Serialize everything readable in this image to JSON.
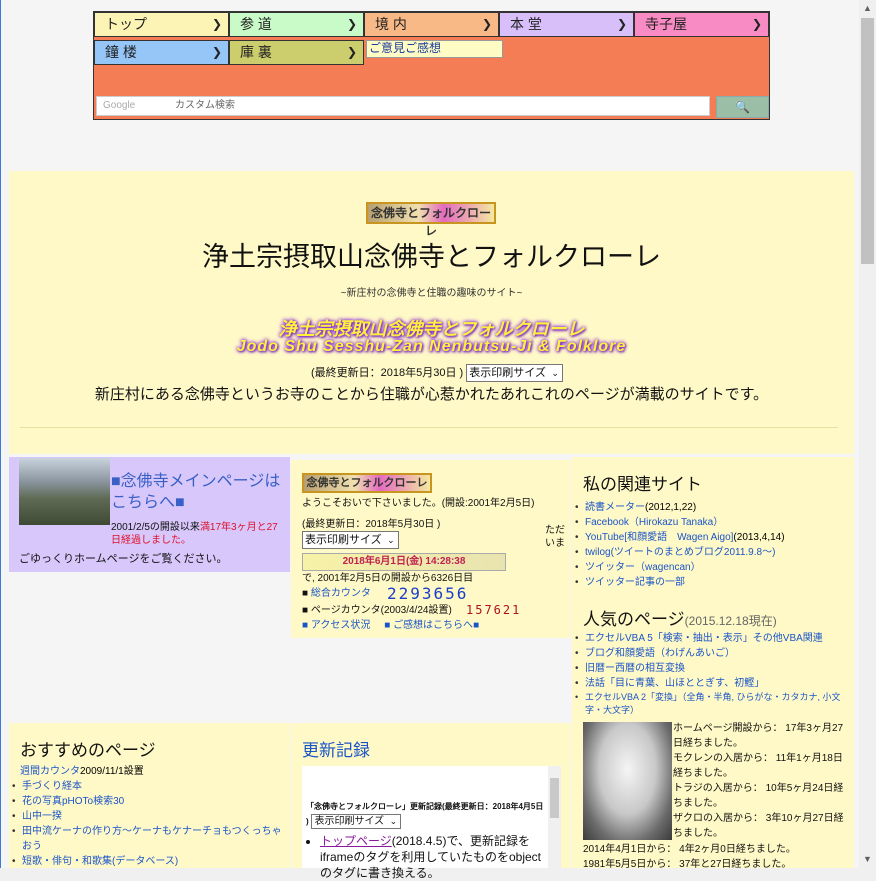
{
  "nav": {
    "items": [
      {
        "label": "トップ",
        "color": "#fcf4b5"
      },
      {
        "label": "参 道",
        "color": "#c9fbc9"
      },
      {
        "label": "境 内",
        "color": "#f9b987"
      },
      {
        "label": "本 堂",
        "color": "#d8bffa"
      },
      {
        "label": "寺子屋",
        "color": "#f98bc4"
      },
      {
        "label": "鐘 楼",
        "color": "#96c5f8"
      },
      {
        "label": "庫 裏",
        "color": "#cccd6c"
      }
    ],
    "dropdown_item": "ご意見ご感想",
    "search_logo": "Google",
    "search_placeholder": "カスタム検索"
  },
  "banner": {
    "logo_text": "念佛寺とフォルクローレ",
    "title": "浄土宗摂取山念佛寺とフォルクローレ",
    "subtitle": "~新庄村の念佛寺と住職の趣味のサイト~",
    "fancy_title_jp": "浄土宗摂取山念佛寺とフォルクローレ",
    "fancy_title_en": "Jodo Shu Sesshu-Zan Nenbutsu-Ji & Folklore",
    "updated": "(最終更新日：2018年5月30日 )",
    "print_select": "表示印刷サイズ",
    "tagline": "新庄村にある念佛寺というお寺のことから住職が心惹かれたあれこれのページが満載のサイトです。"
  },
  "mainlink": {
    "title": "■念佛寺メインページはこちらへ■",
    "opened": "2001/2/5の開設以来",
    "elapsed": "満17年3ヶ月と27日経過しました。",
    "welcome": "ごゆっくりホームページをご覧ください。"
  },
  "counter": {
    "logo_text": "念佛寺とフォルクローレ",
    "welcome": "ようこそおいで下さいました。(開設:2001年2月5日)",
    "updated": "(最終更新日：2018年5月30日 )",
    "print_select": "表示印刷サイズ",
    "tail": "ただいま",
    "datetime": "2018年6月1日(金) 14:28:38",
    "since": "で, 2001年2月5日の開設から6326日目",
    "total_label": "総合カウンタ",
    "total_value": "2293656",
    "page_label": "ページカウンタ(2003/4/24設置)",
    "page_value": "157621",
    "access_link": "アクセス状況",
    "feedback_link": "ご感想はこちらへ"
  },
  "related": {
    "title": "私の関連サイト",
    "items": [
      {
        "link": "読書メーター",
        "note": "(2012,1,22)"
      },
      {
        "link": "Facebook（Hirokazu Tanaka）",
        "note": ""
      },
      {
        "link": "YouTube[和顔愛語　Wagen Aigo]",
        "note": "(2013,4,14)"
      },
      {
        "link": "twilog(ツイートのまとめブログ2011.9.8～)",
        "note": ""
      },
      {
        "link": "ツイッター（wagencan）",
        "note": ""
      },
      {
        "link": "ツイッター記事の一部",
        "note": ""
      }
    ]
  },
  "popular": {
    "title": "人気のページ",
    "as_of": "(2015.12.18現在)",
    "items": [
      "エクセルVBA 5「検索・抽出・表示」その他VBA関連",
      "ブログ和顔愛語（わげんあいご）",
      "旧暦ー西暦の相互変換",
      "法話「目に青葉、山ほととぎす、初鰹」",
      "エクセルVBA 2「変換」（全角・半角, ひらがな・カタカナ, 小文字・大文字）"
    ]
  },
  "cat": {
    "lines": [
      "ホームページ開設から： 17年3ヶ月27日経ちました。",
      "モクレンの入居から： 11年1ヶ月18日経ちました。",
      "トラジの入居から： 10年5ヶ月24日経ちました。",
      "ザクロの入居から： 3年10ヶ月27日経ちました。"
    ],
    "lines2": [
      "2014年4月1日から： 4年2ヶ月0日経ちました。",
      "1981年5月5日から： 37年と27日経ちました。"
    ]
  },
  "recommend": {
    "title": "おすすめのページ",
    "items": [
      {
        "link": "週間カウンタ",
        "note": "2009/11/1設置"
      },
      {
        "link": "手づくり経本",
        "note": ""
      },
      {
        "link": "花の写真pHOTo検索30",
        "note": ""
      },
      {
        "link": "山中一揆",
        "note": ""
      },
      {
        "link": "田中流ケーナの作り方～ケーナもケナーチョもつくっちゃおう",
        "note": ""
      },
      {
        "link": "短歌・俳句・和歌集(データベース)",
        "note": ""
      }
    ]
  },
  "updates": {
    "title": "更新記録",
    "header": "「念佛寺とフォルクローレ」更新記録(最終更新日：2018年4月5日 )",
    "print_select": "表示印刷サイズ",
    "entry_link": "トップページ",
    "entry_text": "(2018.4.5)で、更新記録をiframeのタグを利用していたものをobjectのタグに書き換える。"
  }
}
